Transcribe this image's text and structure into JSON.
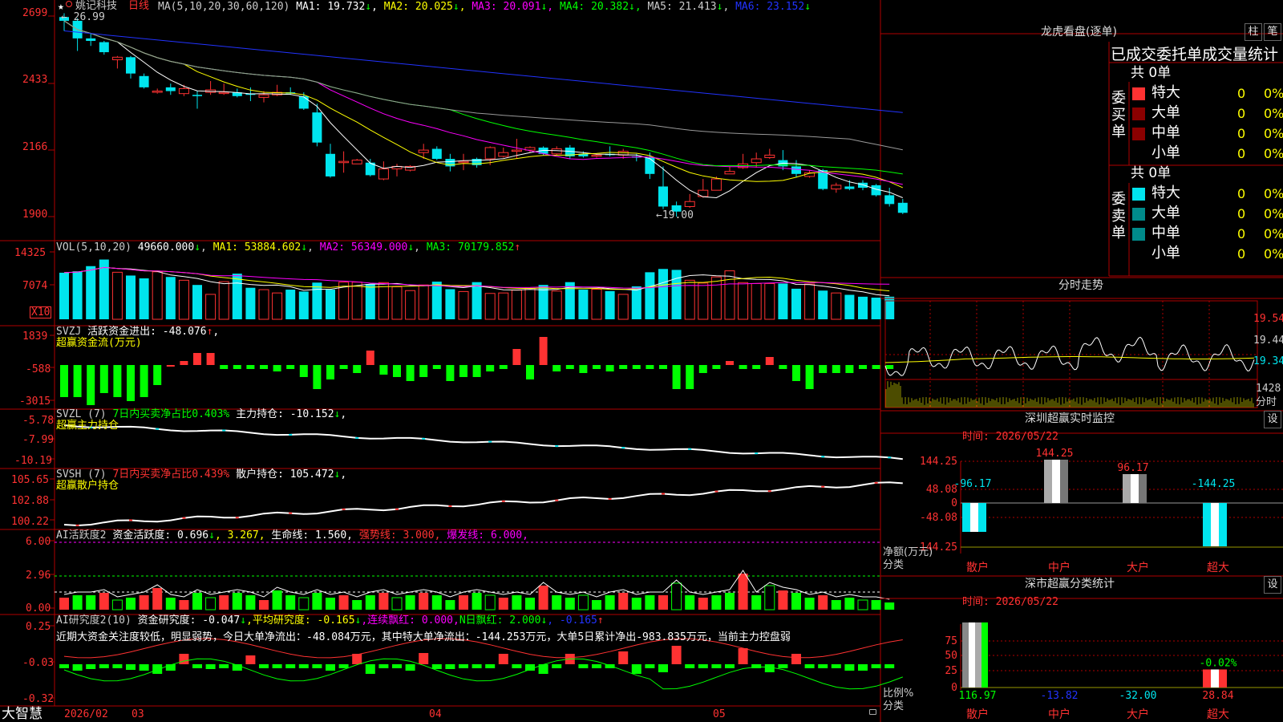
{
  "colors": {
    "up": "#ff3232",
    "down": "#00e5ee",
    "green": "#00ff00",
    "yellow": "#ffff00",
    "magenta": "#ff00ff",
    "white": "#ffffff",
    "blue": "#2233ff",
    "grey": "#999999",
    "gridred": "#b00000",
    "olive": "#999900",
    "darkred": "#8b0000",
    "teal": "#008b8b"
  },
  "main": {
    "star_icon": "★",
    "stock_name": "姚记科技",
    "period": "日线",
    "ma_header": "MA(5,10,20,30,60,120)",
    "ma_values": [
      {
        "label": "MA1: 19.732",
        "arrow": "↓"
      },
      {
        "label": "MA2: 20.025",
        "arrow": "↓"
      },
      {
        "label": "MA3: 20.091",
        "arrow": "↓"
      },
      {
        "label": "MA4: 20.382",
        "arrow": "↓"
      },
      {
        "label": "MA5: 21.413",
        "arrow": "↓"
      },
      {
        "label": "MA6: 23.152",
        "arrow": "↓"
      }
    ],
    "y_ticks": [
      "2699",
      "2433",
      "2166",
      "1900"
    ],
    "high_mark": "26.99",
    "low_mark": "19.00"
  },
  "vol": {
    "header": "VOL(5,10,20)",
    "value": "49660.000",
    "v_arrow": "↓",
    "ma1": "MA1: 53884.602",
    "ma1_arrow": "↓",
    "ma2": "MA2: 56349.000",
    "ma2_arrow": "↓",
    "ma3": "MA3: 70179.852",
    "ma3_arrow": "↑",
    "y_ticks": [
      "14325",
      "7074"
    ],
    "unit": "X10"
  },
  "svzj": {
    "header": "SVZJ",
    "label": "活跃资金进出: -48.076",
    "arrow": "↑",
    "suffix": ",",
    "title": "超赢资金流(万元)",
    "y_ticks": [
      "1839",
      "-588",
      "-3015"
    ]
  },
  "svzl": {
    "header": "SVZL (7)",
    "ratio": "7日内买卖净占比0.403%",
    "hold": "主力持仓: -10.152",
    "arrow": "↓",
    "suffix": ",",
    "title": "超赢主力持仓",
    "y_ticks": [
      "-5.78",
      "-7.99",
      "-10.19"
    ]
  },
  "svsh": {
    "header": "SVSH (7)",
    "ratio": "7日内买卖净占比0.439%",
    "hold": "散户持仓: 105.472",
    "arrow": "↓",
    "suffix": ",",
    "title": "超赢散户持仓",
    "y_ticks": [
      "105.65",
      "102.88",
      "100.22"
    ]
  },
  "ai_act": {
    "header": "AI活跃度2",
    "p1": "资金活跃度: 0.696",
    "a1": "↓",
    "p2": ", 3.267,",
    "p3": "生命线: 1.560,",
    "p4": "强势线: 3.000,",
    "p5": "爆发线: 6.000,",
    "y_ticks": [
      "6.00",
      "2.96",
      "0.00"
    ]
  },
  "ai_res": {
    "header": "AI研究度2(10)",
    "p1": "资金研究度: -0.047",
    "a1": "↓",
    "p2": ",平均研究度: -0.165",
    "a2": "↓",
    "p3": ",连续飘红: 0.000,",
    "p4": "N日飘红: 2.000",
    "a4": "↓",
    "p5": ", -0.165",
    "a5": "↑",
    "commentary": "近期大资金关注度较低，明显弱势，今日大单净流出：-48.084万元，其中特大单净流出：-144.253万元，大单5日累计净出-983.835万元，当前主力控盘弱",
    "y_ticks": [
      "0.25",
      "-0.03",
      "-0.32"
    ]
  },
  "bottom": {
    "logo": "大智慧",
    "dates": [
      "2026/02",
      "03",
      "04",
      "05"
    ],
    "lock_icon": "lock-icon"
  },
  "right": {
    "dragon_title": "龙虎看盘(逐单)",
    "btn_bar": "柱",
    "btn_pen": "笔",
    "stats_title": "已成交委托单成交量统计",
    "buy_section": {
      "label": "委买单",
      "total": "共 0单",
      "rows": [
        {
          "name": "特大",
          "value": "0",
          "pct": "0%"
        },
        {
          "name": "大单",
          "value": "0",
          "pct": "0%"
        },
        {
          "name": "中单",
          "value": "0",
          "pct": "0%"
        },
        {
          "name": "小单",
          "value": "0",
          "pct": "0%"
        }
      ]
    },
    "sell_section": {
      "label": "委卖单",
      "total": "共 0单",
      "rows": [
        {
          "name": "特大",
          "value": "0",
          "pct": "0%"
        },
        {
          "name": "大单",
          "value": "0",
          "pct": "0%"
        },
        {
          "name": "中单",
          "value": "0",
          "pct": "0%"
        },
        {
          "name": "小单",
          "value": "0",
          "pct": "0%"
        }
      ]
    },
    "intraday_title": "分时走势",
    "intraday_ticks": [
      "19.54",
      "19.44",
      "19.34"
    ],
    "intraday_vol": "1428",
    "intraday_unit": "分时",
    "monitor": {
      "title": "深圳超赢实时监控",
      "setting": "设",
      "time": "时间: 2026/05/22",
      "y_ticks": [
        "144.25",
        "48.08",
        "0",
        "-48.08",
        "-144.25"
      ],
      "ylabel1": "净额(万元)",
      "ylabel2": "分类",
      "cats": [
        "散户",
        "中户",
        "大户",
        "超大"
      ],
      "values": [
        -96.17,
        144.25,
        96.17,
        -144.25
      ],
      "value_labels": [
        "-96.17",
        "144.25",
        "96.17",
        "-144.25"
      ]
    },
    "classify": {
      "title": "深市超赢分类统计",
      "setting": "设",
      "time": "时间: 2026/05/22",
      "y_ticks": [
        "75",
        "50",
        "25",
        "0"
      ],
      "ylabel1": "比例%",
      "ylabel2": "分类",
      "cats": [
        "散户",
        "中户",
        "大户",
        "超大"
      ],
      "values": [
        116.97,
        -13.82,
        -32.0,
        28.84
      ],
      "value_labels": [
        "116.97",
        "-13.82",
        "-32.00",
        "28.84"
      ],
      "pct_label": "-0.02%"
    }
  },
  "chart_data": {
    "type": "candlestick",
    "title": "姚记科技 日线",
    "candles": [
      {
        "o": 26.95,
        "h": 27.1,
        "c": 26.8,
        "l": 26.4
      },
      {
        "o": 26.8,
        "h": 26.9,
        "c": 26.1,
        "l": 25.6
      },
      {
        "o": 26.1,
        "h": 26.3,
        "c": 26.0,
        "l": 25.8
      },
      {
        "o": 25.95,
        "h": 26.0,
        "c": 25.55,
        "l": 25.45
      },
      {
        "o": 25.25,
        "h": 25.4,
        "c": 25.35,
        "l": 24.9
      },
      {
        "o": 25.35,
        "h": 25.4,
        "c": 24.7,
        "l": 24.5
      },
      {
        "o": 24.6,
        "h": 24.7,
        "c": 24.15,
        "l": 24.1
      },
      {
        "o": 24.0,
        "h": 24.1,
        "c": 24.0,
        "l": 23.9
      },
      {
        "o": 24.15,
        "h": 24.3,
        "c": 24.0,
        "l": 23.85
      },
      {
        "o": 23.9,
        "h": 24.25,
        "c": 24.1,
        "l": 23.8
      },
      {
        "o": 23.85,
        "h": 24.0,
        "c": 23.8,
        "l": 23.3
      },
      {
        "o": 23.95,
        "h": 24.4,
        "c": 24.05,
        "l": 23.85
      },
      {
        "o": 23.95,
        "h": 24.3,
        "c": 23.95,
        "l": 23.85
      },
      {
        "o": 23.95,
        "h": 24.1,
        "c": 23.8,
        "l": 23.75
      },
      {
        "o": 23.9,
        "h": 24.15,
        "c": 23.85,
        "l": 23.6
      },
      {
        "o": 23.75,
        "h": 24.0,
        "c": 23.85,
        "l": 23.55
      },
      {
        "o": 23.85,
        "h": 24.25,
        "c": 23.95,
        "l": 23.8
      },
      {
        "o": 23.95,
        "h": 24.15,
        "c": 23.9,
        "l": 23.85
      },
      {
        "o": 23.8,
        "h": 23.95,
        "c": 23.3,
        "l": 23.25
      },
      {
        "o": 23.15,
        "h": 23.5,
        "c": 21.95,
        "l": 21.8
      },
      {
        "o": 21.5,
        "h": 21.9,
        "c": 20.6,
        "l": 20.55
      },
      {
        "o": 21.15,
        "h": 21.6,
        "c": 21.2,
        "l": 20.75
      },
      {
        "o": 21.1,
        "h": 21.3,
        "c": 21.25,
        "l": 21.1
      },
      {
        "o": 21.15,
        "h": 21.3,
        "c": 20.65,
        "l": 20.6
      },
      {
        "o": 20.5,
        "h": 21.2,
        "c": 20.9,
        "l": 20.45
      },
      {
        "o": 20.9,
        "h": 21.1,
        "c": 21.0,
        "l": 20.6
      },
      {
        "o": 20.85,
        "h": 21.05,
        "c": 21.0,
        "l": 20.8
      },
      {
        "o": 21.55,
        "h": 21.9,
        "c": 21.65,
        "l": 21.3
      },
      {
        "o": 21.7,
        "h": 21.8,
        "c": 21.3,
        "l": 21.25
      },
      {
        "o": 21.3,
        "h": 21.5,
        "c": 21.0,
        "l": 20.8
      },
      {
        "o": 21.15,
        "h": 21.5,
        "c": 21.2,
        "l": 20.85
      },
      {
        "o": 21.3,
        "h": 21.35,
        "c": 21.05,
        "l": 20.95
      },
      {
        "o": 21.3,
        "h": 21.8,
        "c": 21.75,
        "l": 21.05
      },
      {
        "o": 21.4,
        "h": 21.75,
        "c": 21.55,
        "l": 21.35
      },
      {
        "o": 21.6,
        "h": 22.1,
        "c": 21.65,
        "l": 21.3
      },
      {
        "o": 21.65,
        "h": 21.8,
        "c": 21.75,
        "l": 21.55
      },
      {
        "o": 21.75,
        "h": 21.8,
        "c": 21.5,
        "l": 21.45
      },
      {
        "o": 21.5,
        "h": 21.8,
        "c": 21.7,
        "l": 21.45
      },
      {
        "o": 21.75,
        "h": 21.85,
        "c": 21.4,
        "l": 21.3
      },
      {
        "o": 21.5,
        "h": 21.6,
        "c": 21.4,
        "l": 21.35
      },
      {
        "o": 21.45,
        "h": 21.5,
        "c": 21.45,
        "l": 21.35
      },
      {
        "o": 21.5,
        "h": 21.8,
        "c": 21.45,
        "l": 21.4
      },
      {
        "o": 21.45,
        "h": 21.7,
        "c": 21.6,
        "l": 21.3
      },
      {
        "o": 21.4,
        "h": 21.5,
        "c": 21.35,
        "l": 21.2
      },
      {
        "o": 21.35,
        "h": 21.55,
        "c": 20.7,
        "l": 20.5
      },
      {
        "o": 20.2,
        "h": 21.0,
        "c": 19.4,
        "l": 19.3
      },
      {
        "o": 19.45,
        "h": 19.6,
        "c": 19.2,
        "l": 19.0
      },
      {
        "o": 19.4,
        "h": 19.9,
        "c": 19.6,
        "l": 19.35
      },
      {
        "o": 19.8,
        "h": 20.5,
        "c": 20.05,
        "l": 19.75
      },
      {
        "o": 20.05,
        "h": 20.6,
        "c": 20.5,
        "l": 20.05
      },
      {
        "o": 20.7,
        "h": 21.0,
        "c": 20.8,
        "l": 20.7
      },
      {
        "o": 20.95,
        "h": 21.5,
        "c": 21.1,
        "l": 20.9
      },
      {
        "o": 21.15,
        "h": 21.55,
        "c": 21.3,
        "l": 20.95
      },
      {
        "o": 21.35,
        "h": 21.7,
        "c": 21.45,
        "l": 21.3
      },
      {
        "o": 21.25,
        "h": 21.65,
        "c": 21.0,
        "l": 20.85
      },
      {
        "o": 21.0,
        "h": 21.25,
        "c": 20.7,
        "l": 20.55
      },
      {
        "o": 20.6,
        "h": 20.85,
        "c": 20.75,
        "l": 20.55
      },
      {
        "o": 20.85,
        "h": 20.9,
        "c": 20.1,
        "l": 20.05
      },
      {
        "o": 20.1,
        "h": 20.35,
        "c": 20.25,
        "l": 19.95
      },
      {
        "o": 20.2,
        "h": 20.45,
        "c": 20.1,
        "l": 20.05
      },
      {
        "o": 20.35,
        "h": 20.45,
        "c": 20.15,
        "l": 20.05
      },
      {
        "o": 20.25,
        "h": 20.3,
        "c": 19.85,
        "l": 19.8
      },
      {
        "o": 19.85,
        "h": 20.15,
        "c": 19.5,
        "l": 19.4
      },
      {
        "o": 19.55,
        "h": 19.7,
        "c": 19.15,
        "l": 19.1
      }
    ],
    "volumes": [
      9.9,
      10.2,
      11.3,
      12.7,
      10.0,
      9.3,
      8.7,
      10.1,
      9.0,
      8.3,
      7.3,
      5.3,
      8.0,
      9.7,
      6.7,
      6.3,
      5.6,
      6.3,
      5.9,
      7.8,
      6.3,
      7.9,
      7.9,
      7.5,
      7.8,
      6.9,
      6.1,
      7.3,
      8.0,
      6.4,
      5.9,
      7.9,
      5.5,
      5.6,
      6.2,
      6.6,
      7.3,
      6.0,
      7.9,
      6.3,
      6.4,
      6.0,
      5.3,
      7.0,
      10.0,
      10.7,
      10.5,
      8.3,
      7.7,
      9.0,
      10.3,
      7.8,
      7.6,
      7.6,
      7.6,
      6.5,
      7.5,
      6.1,
      5.6,
      5.2,
      4.8,
      4.6,
      4.8
    ]
  }
}
